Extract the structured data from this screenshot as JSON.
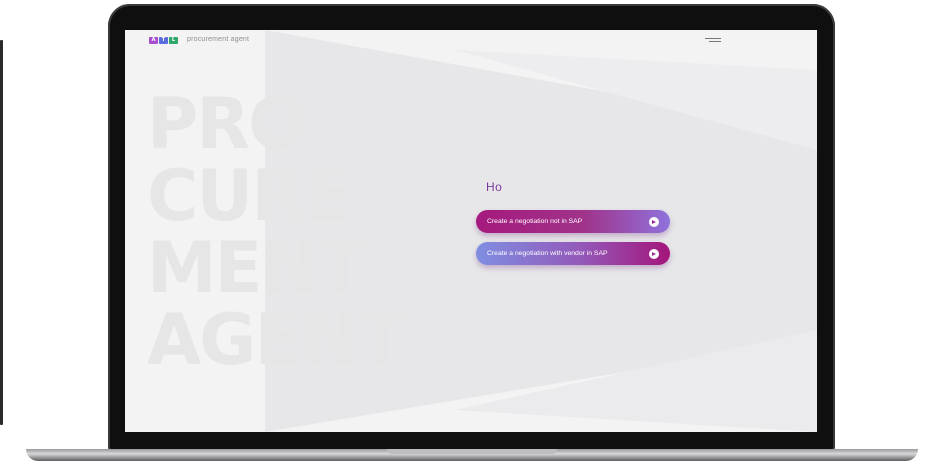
{
  "app": {
    "logo_letters": [
      "A",
      "T",
      "L"
    ],
    "logo_colors": [
      "#a84fd0",
      "#5b6be0",
      "#2fa76b"
    ],
    "brand_name": "procurement agent"
  },
  "hero": {
    "lines": [
      "PRO",
      "CURE",
      "MENT",
      "AGENT"
    ]
  },
  "main": {
    "greeting": "Ho",
    "actions": [
      {
        "label": "Create a negotiation not in SAP"
      },
      {
        "label": "Create a negotiation with vendor in SAP"
      }
    ]
  },
  "theme": {
    "accent_magenta": "#a5197d",
    "accent_violet": "#8f72dc",
    "background": "#f3f3f4"
  }
}
